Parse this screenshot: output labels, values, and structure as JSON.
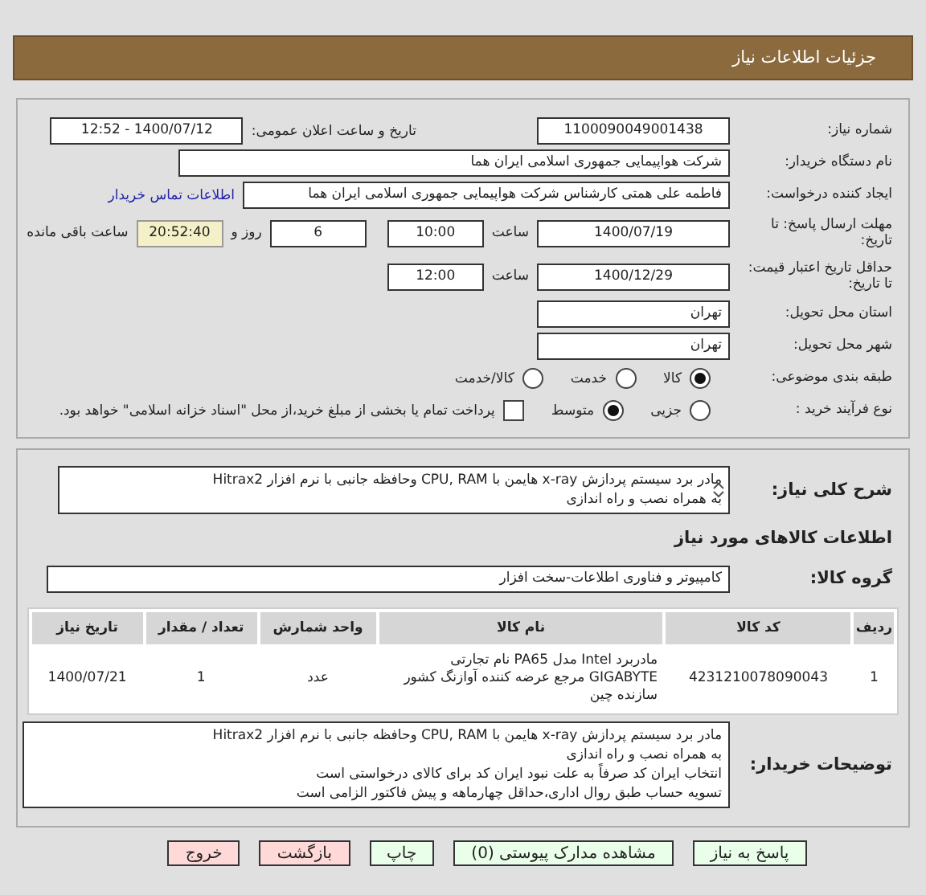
{
  "header": {
    "title": "جزئیات اطلاعات نیاز"
  },
  "need_number": {
    "label": "شماره نیاز:",
    "value": "1100090049001438"
  },
  "announce": {
    "label": "تاریخ و ساعت اعلان عمومی:",
    "value": "1400/07/12 - 12:52"
  },
  "buyer_org": {
    "label": "نام دستگاه خریدار:",
    "value": "شرکت هواپیمایی جمهوری اسلامی ایران هما"
  },
  "requester": {
    "label": "ایجاد کننده درخواست:",
    "value": "فاطمه علی همتی کارشناس شرکت هواپیمایی جمهوری اسلامی ایران هما",
    "link": "اطلاعات تماس خریدار"
  },
  "deadline": {
    "label": "مهلت ارسال پاسخ: تا تاریخ:",
    "date": "1400/07/19",
    "time_label": "ساعت",
    "time": "10:00",
    "days": "6",
    "days_label": "روز و",
    "remaining": "20:52:40",
    "remaining_label": "ساعت باقی مانده"
  },
  "validity": {
    "label": "حداقل تاریخ اعتبار قیمت: تا تاریخ:",
    "date": "1400/12/29",
    "time_label": "ساعت",
    "time": "12:00"
  },
  "province": {
    "label": "استان محل تحویل:",
    "value": "تهران"
  },
  "city": {
    "label": "شهر محل تحویل:",
    "value": "تهران"
  },
  "category": {
    "label": "طبقه بندی موضوعی:",
    "options": [
      {
        "label": "کالا",
        "selected": true
      },
      {
        "label": "خدمت",
        "selected": false
      },
      {
        "label": "کالا/خدمت",
        "selected": false
      }
    ]
  },
  "process": {
    "label": "نوع فرآیند خرید :",
    "options": [
      {
        "label": "جزیی",
        "selected": false
      },
      {
        "label": "متوسط",
        "selected": true
      }
    ],
    "checkbox": {
      "label": "پرداخت تمام یا بخشی از مبلغ خرید،از محل \"اسناد خزانه اسلامی\" خواهد بود.",
      "checked": false
    }
  },
  "description": {
    "label": "شرح کلی نیاز:",
    "lines": [
      "مادر برد سیستم پردازش x-ray هایمن با CPU, RAM وحافظه جانبی  با نرم افزار Hitrax2",
      "به همراه نصب و راه اندازی"
    ]
  },
  "goods_title": "اطلاعات کالاهای مورد نیاز",
  "goods_group": {
    "label": "گروه کالا:",
    "value": "کامپیوتر و فناوری اطلاعات-سخت افزار"
  },
  "table": {
    "columns": [
      "ردیف",
      "کد کالا",
      "نام کالا",
      "واحد شمارش",
      "تعداد / مقدار",
      "تاریخ نیاز"
    ],
    "rows": [
      [
        "1",
        "4231210078090043",
        "مادربرد Intel مدل PA65 نام تجارتی GIGABYTE مرجع عرضه کننده آوازنگ کشور سازنده چین",
        "عدد",
        "1",
        "1400/07/21"
      ]
    ]
  },
  "notes": {
    "label": "توضیحات خریدار:",
    "lines": [
      "مادر برد سیستم پردازش x-ray هایمن با CPU, RAM وحافظه جانبی  با نرم افزار Hitrax2",
      "به همراه نصب و راه اندازی",
      "انتخاب ایران کد صرفاً به علت نبود ایران کد برای کالای درخواستی است",
      "تسویه حساب طبق روال اداری،حداقل چهارماهه و پیش فاکتور الزامی است"
    ]
  },
  "buttons": [
    {
      "label": "پاسخ به نیاز",
      "color": "#eaffea"
    },
    {
      "label": "مشاهده مدارک پیوستی (0)",
      "color": "#eaffea"
    },
    {
      "label": "چاپ",
      "color": "#eaffea"
    },
    {
      "label": "بازگشت",
      "color": "#ffd8d8"
    },
    {
      "label": "خروج",
      "color": "#ffd8d8"
    }
  ]
}
